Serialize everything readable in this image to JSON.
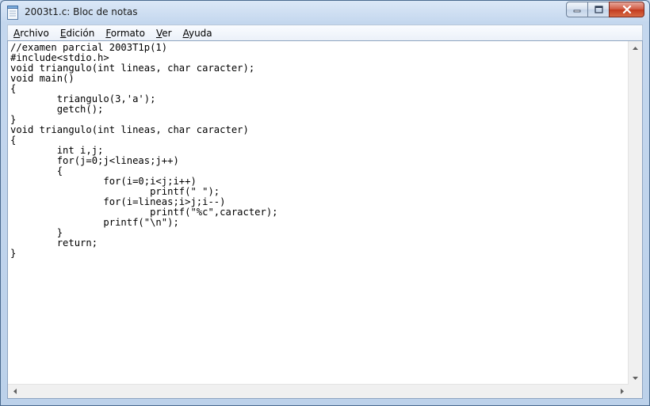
{
  "window": {
    "title": "2003t1.c: Bloc de notas"
  },
  "menu": [
    {
      "label": "Archivo",
      "underline": "A",
      "rest": "rchivo"
    },
    {
      "label": "Edición",
      "underline": "E",
      "rest": "dición"
    },
    {
      "label": "Formato",
      "underline": "F",
      "rest": "ormato"
    },
    {
      "label": "Ver",
      "underline": "V",
      "rest": "er"
    },
    {
      "label": "Ayuda",
      "underline": "A",
      "rest": "yuda"
    }
  ],
  "document": {
    "lines": [
      "//examen parcial 2003T1p(1)",
      "#include<stdio.h>",
      "void triangulo(int lineas, char caracter);",
      "void main()",
      "{",
      "        triangulo(3,'a');",
      "        getch();",
      "}",
      "void triangulo(int lineas, char caracter)",
      "{",
      "        int i,j;",
      "        for(j=0;j<lineas;j++)",
      "        {",
      "                for(i=0;i<j;i++)",
      "                        printf(\" \");",
      "                for(i=lineas;i>j;i--)",
      "                        printf(\"%c\",caracter);",
      "                printf(\"\\n\");",
      "        }",
      "        return;",
      "}"
    ]
  }
}
